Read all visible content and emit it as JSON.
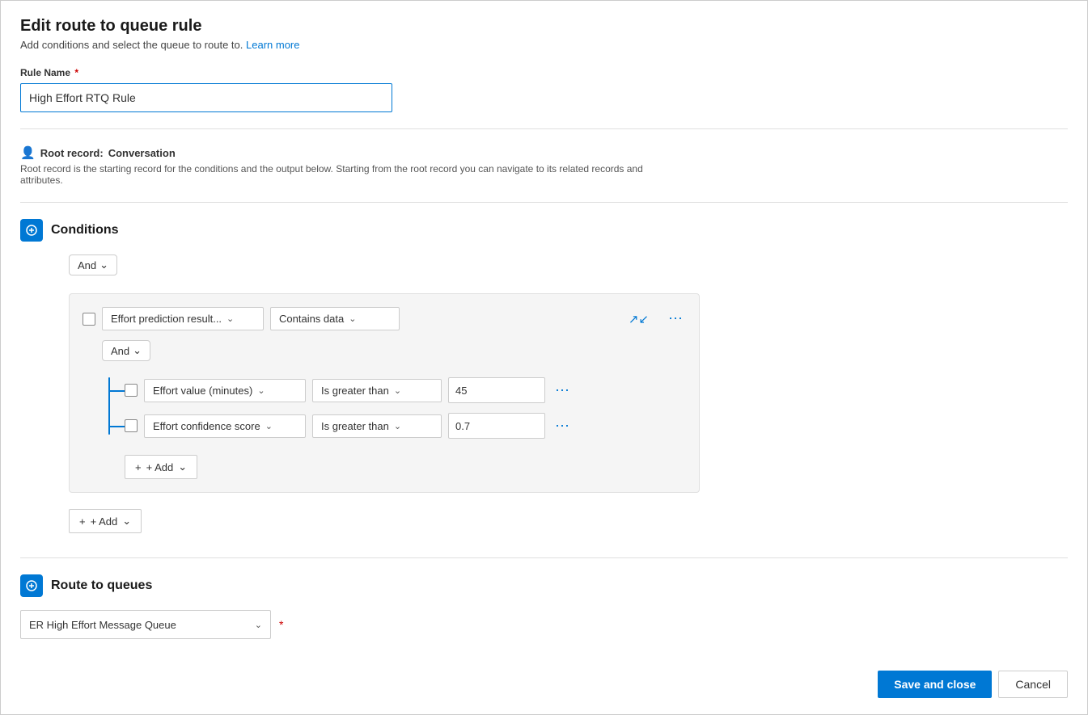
{
  "page": {
    "title": "Edit route to queue rule",
    "subtitle": "Add conditions and select the queue to route to.",
    "learn_more": "Learn more"
  },
  "form": {
    "rule_name_label": "Rule Name",
    "rule_name_value": "High Effort RTQ Rule",
    "root_record_label": "Root record:",
    "root_record_value": "Conversation",
    "root_record_desc": "Root record is the starting record for the conditions and the output below. Starting from the root record you can navigate to its related records and attributes."
  },
  "conditions": {
    "section_title": "Conditions",
    "and_label": "And",
    "condition_row1": {
      "field": "Effort prediction result...",
      "operator": "Contains data"
    },
    "nested_and_label": "And",
    "condition_row2": {
      "field": "Effort value (minutes)",
      "operator": "Is greater than",
      "value": "45"
    },
    "condition_row3": {
      "field": "Effort confidence score",
      "operator": "Is greater than",
      "value": "0.7"
    },
    "add_inner_label": "+ Add",
    "add_outer_label": "+ Add"
  },
  "route_to_queues": {
    "section_title": "Route to queues",
    "queue_value": "ER High Effort Message Queue",
    "required_marker": "*"
  },
  "footer": {
    "save_label": "Save and close",
    "cancel_label": "Cancel"
  }
}
